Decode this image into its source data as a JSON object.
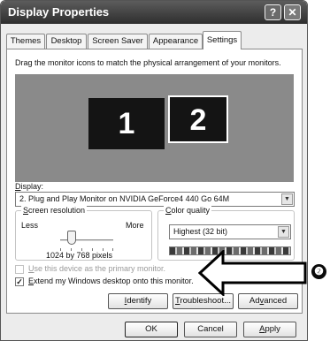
{
  "window": {
    "title": "Display Properties"
  },
  "title_buttons": {
    "help": "?",
    "close": "✕"
  },
  "tabs": [
    {
      "label": "Themes"
    },
    {
      "label": "Desktop"
    },
    {
      "label": "Screen Saver"
    },
    {
      "label": "Appearance"
    },
    {
      "label": "Settings"
    }
  ],
  "active_tab": "Settings",
  "instruction": "Drag the monitor icons to match the physical arrangement of your monitors.",
  "monitors": [
    {
      "label": "1"
    },
    {
      "label": "2",
      "selected": true
    }
  ],
  "display": {
    "label_first": "D",
    "label_rest": "isplay:",
    "value": "2. Plug and Play Monitor on NVIDIA GeForce4 440 Go 64M"
  },
  "resolution": {
    "title_first": "S",
    "title_rest": "creen resolution",
    "less": "Less",
    "more": "More",
    "value_text": "1024 by 768 pixels"
  },
  "color_quality": {
    "title_first": "C",
    "title_rest": "olor quality",
    "value": "Highest (32 bit)"
  },
  "checkboxes": {
    "primary": {
      "first": "U",
      "rest": "se this device as the primary monitor.",
      "checked": false,
      "disabled": true
    },
    "extend": {
      "first": "E",
      "rest": "xtend my Windows desktop onto this monitor.",
      "checked": true,
      "disabled": false
    }
  },
  "buttons": {
    "identify": {
      "first": "I",
      "rest": "dentify"
    },
    "troubleshoot": {
      "first": "T",
      "rest": "roubleshoot..."
    },
    "advanced": {
      "pre": "Ad",
      "u": "v",
      "post": "anced"
    },
    "ok": "OK",
    "cancel": "Cancel",
    "apply": {
      "first": "A",
      "rest": "pply"
    }
  },
  "callout": {
    "number": "❷"
  },
  "colors": {
    "titlebar": "#3d3d3d",
    "monitor_area": "#8a8a8a",
    "monitor": "#141414"
  }
}
